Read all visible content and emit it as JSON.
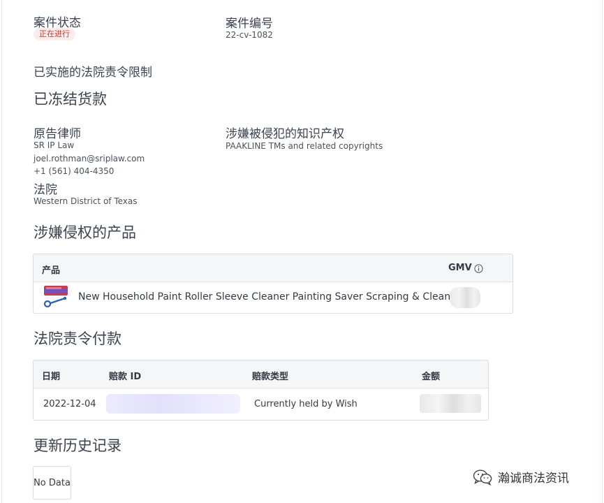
{
  "case": {
    "status_label": "案件状态",
    "status_badge": "正在进行",
    "number_label": "案件编号",
    "number_value": "22-cv-1082"
  },
  "restraint": {
    "label": "已实施的法院责令限制",
    "value": "已冻结货款"
  },
  "plaintiff_counsel": {
    "label": "原告律师",
    "firm": "SR IP Law",
    "email": "joel.rothman@sriplaw.com",
    "phone": "+1 (561) 404-4350"
  },
  "ip": {
    "label": "涉嫌被侵犯的知识产权",
    "value": "PAAKLINE TMs and related copyrights"
  },
  "court": {
    "label": "法院",
    "value": "Western District of Texas"
  },
  "products": {
    "heading": "涉嫌侵权的产品",
    "col_product": "产品",
    "col_gmv": "GMV",
    "rows": [
      {
        "name": "New Household Paint Roller Sleeve Cleaner Painting Saver Scraping & Clean..."
      }
    ]
  },
  "payments": {
    "heading": "法院责令付款",
    "col_date": "日期",
    "col_id": "赔款 ID",
    "col_type": "赔款类型",
    "col_amount": "金额",
    "rows": [
      {
        "date": "2022-12-04",
        "type": "Currently held by Wish"
      }
    ]
  },
  "history": {
    "heading": "更新历史记录",
    "empty": "No Data"
  },
  "watermark": {
    "text": "瀚诚商法资讯"
  },
  "icons": {
    "gmv_info": "info-circle-icon",
    "product_thumb": "paint-roller-image",
    "watermark_logo": "wechat-icon"
  }
}
